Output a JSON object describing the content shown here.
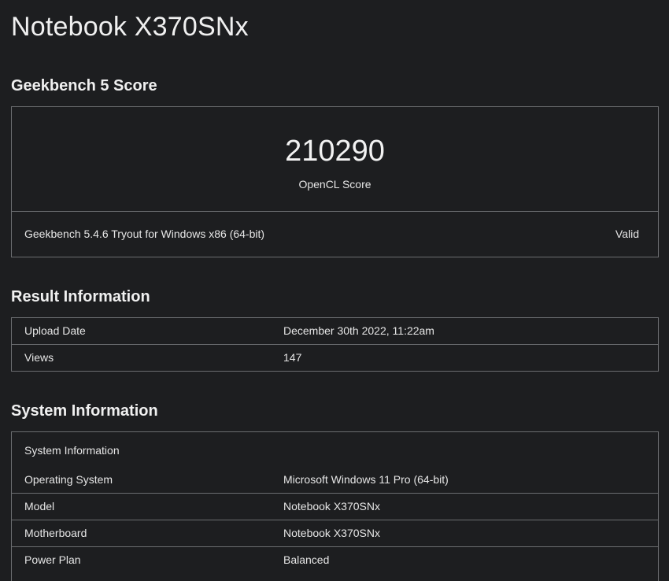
{
  "page_title": "Notebook X370SNx",
  "score_section": {
    "title": "Geekbench 5 Score",
    "score": "210290",
    "score_label": "OpenCL Score",
    "version": "Geekbench 5.4.6 Tryout for Windows x86 (64-bit)",
    "status": "Valid"
  },
  "result_section": {
    "title": "Result Information",
    "rows": [
      {
        "key": "Upload Date",
        "value": "December 30th 2022, 11:22am"
      },
      {
        "key": "Views",
        "value": "147"
      }
    ]
  },
  "system_section": {
    "title": "System Information",
    "subheading": "System Information",
    "rows": [
      {
        "key": "Operating System",
        "value": "Microsoft Windows 11 Pro (64-bit)"
      },
      {
        "key": "Model",
        "value": "Notebook X370SNx"
      },
      {
        "key": "Motherboard",
        "value": "Notebook X370SNx"
      },
      {
        "key": "Power Plan",
        "value": "Balanced"
      }
    ]
  },
  "colors": {
    "background": "#1d1e20",
    "border": "#6b6d70",
    "text": "#e6e6e6"
  }
}
